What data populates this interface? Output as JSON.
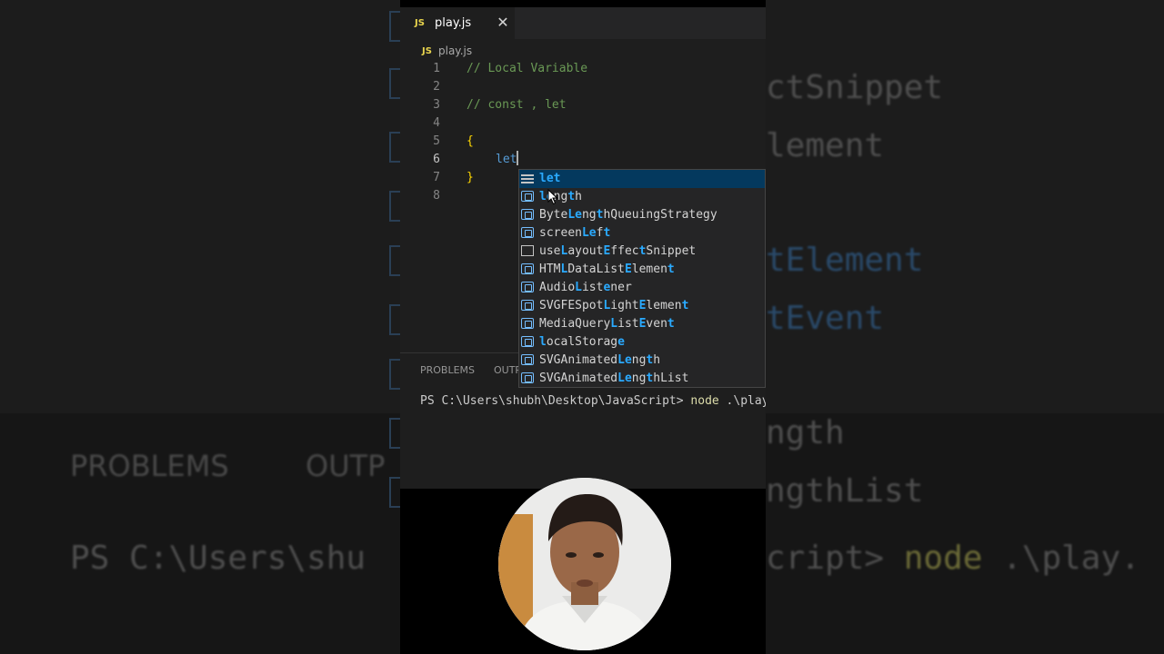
{
  "background": {
    "lines": [
      "ctSnippet",
      "lement",
      "tElement",
      "tEvent",
      "ngth",
      "ngthList"
    ],
    "panel_tab_1": "PROBLEMS",
    "panel_tab_2": "OUTP",
    "terminal_left": "PS C:\\Users\\shu",
    "terminal_right_1": "cript> ",
    "terminal_right_2": "node",
    "terminal_right_3": " .\\play."
  },
  "tab": {
    "badge": "JS",
    "title": "play.js",
    "close": "✕"
  },
  "breadcrumb": {
    "badge": "JS",
    "label": "play.js"
  },
  "editor": {
    "lines": [
      {
        "num": "1",
        "text": "// Local Variable"
      },
      {
        "num": "2",
        "text": ""
      },
      {
        "num": "3",
        "text": "// const , let"
      },
      {
        "num": "4",
        "text": ""
      },
      {
        "num": "5",
        "text": "{"
      },
      {
        "num": "6",
        "text": "let"
      },
      {
        "num": "7",
        "text": "}"
      },
      {
        "num": "8",
        "text": ""
      }
    ]
  },
  "suggestions": [
    {
      "label": "let",
      "icon": "keyword-icon",
      "selected": true
    },
    {
      "label": "length",
      "icon": "variable-icon"
    },
    {
      "label": "ByteLengthQueuingStrategy",
      "icon": "variable-icon"
    },
    {
      "label": "screenLeft",
      "icon": "variable-icon"
    },
    {
      "label": "useLayoutEffectSnippet",
      "icon": "snippet-icon"
    },
    {
      "label": "HTMLDataListElement",
      "icon": "variable-icon"
    },
    {
      "label": "AudioListener",
      "icon": "variable-icon"
    },
    {
      "label": "SVGFESpotLightElement",
      "icon": "variable-icon"
    },
    {
      "label": "MediaQueryListEvent",
      "icon": "variable-icon"
    },
    {
      "label": "localStorage",
      "icon": "variable-icon"
    },
    {
      "label": "SVGAnimatedLength",
      "icon": "variable-icon"
    },
    {
      "label": "SVGAnimatedLengthList",
      "icon": "variable-icon"
    }
  ],
  "panel": {
    "tab_problems": "PROBLEMS",
    "tab_output": "OUTP",
    "terminal_prompt": "PS C:\\Users\\shubh\\Desktop\\JavaScript> ",
    "terminal_cmd": "node",
    "terminal_arg": " .\\play."
  },
  "colors": {
    "editor_bg": "#1e1e1e",
    "comment": "#6a9955",
    "keyword": "#569cd6",
    "brace": "#ffd700",
    "match_highlight": "#2aaaff",
    "selected_suggestion_bg": "#04395e"
  }
}
